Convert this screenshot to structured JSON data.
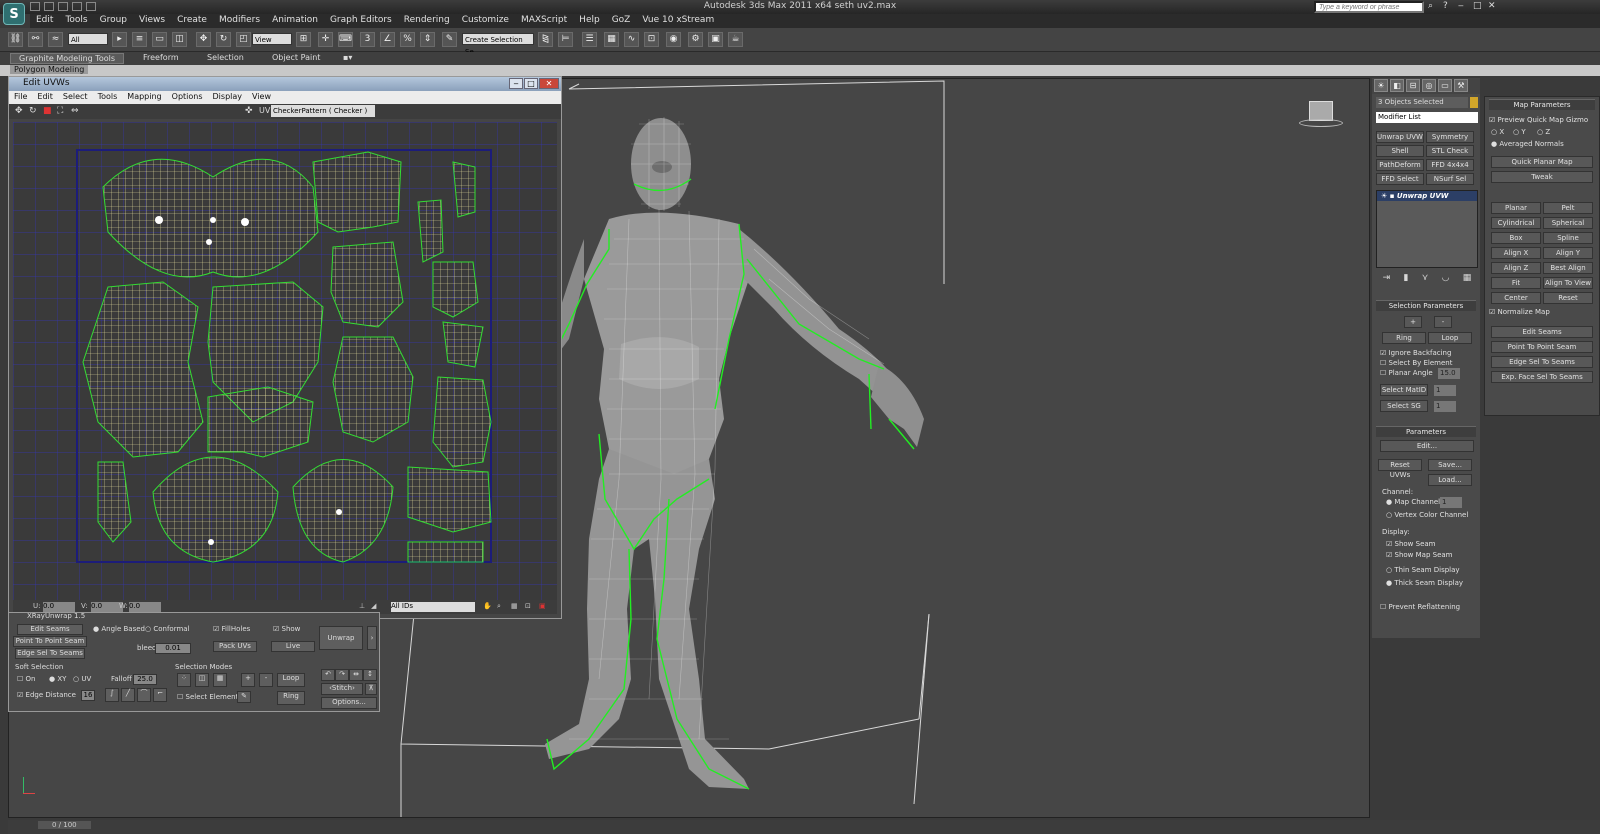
{
  "window": {
    "app_title": "Autodesk 3ds Max  2011 x64      seth uv2.max",
    "logo": "S",
    "search_placeholder": "Type a keyword or phrase"
  },
  "menu": [
    "Edit",
    "Tools",
    "Group",
    "Views",
    "Create",
    "Modifiers",
    "Animation",
    "Graph Editors",
    "Rendering",
    "Customize",
    "MAXScript",
    "Help",
    "GoZ",
    "Vue 10 xStream"
  ],
  "toolbar": {
    "filter": "All",
    "ref_coord": "View",
    "named_selection": "Create Selection Se"
  },
  "ribbon": {
    "tabs": [
      "Graphite Modeling Tools",
      "Freeform",
      "Selection",
      "Object Paint"
    ],
    "sub_tab": "Polygon Modeling"
  },
  "uv_editor": {
    "title": "Edit UVWs",
    "menu": [
      "File",
      "Edit",
      "Select",
      "Tools",
      "Mapping",
      "Options",
      "Display",
      "View"
    ],
    "uv_label": "UV",
    "texture": "CheckerPattern ( Checker )",
    "status": {
      "u_label": "U:",
      "u_value": "0.0",
      "v_label": "V:",
      "v_value": "0.0",
      "w_label": "W:",
      "w_value": "0.0",
      "ids": "All IDs"
    }
  },
  "xray": {
    "title": "XRayUnwrap 1.5",
    "edit_seams": "Edit Seams",
    "point_to_point": "Point To Point Seam",
    "edge_sel": "Edge Sel To Seams",
    "angle_based": "Angle Based",
    "conformal": "Conformal",
    "fill_holes": "FillHoles",
    "show": "Show",
    "unwrap": "Unwrap",
    "bleed_label": "bleed",
    "bleed_value": "0.01",
    "pack_uvs": "Pack UVs",
    "live": "Live",
    "soft_selection": "Soft Selection",
    "on": "On",
    "xy": "XY",
    "uv": "UV",
    "falloff_label": "Falloff",
    "falloff_value": "25.0",
    "edge_distance": "Edge Distance",
    "edge_distance_value": "16",
    "selection_modes": "Selection Modes",
    "select_element": "Select Element",
    "loop": "Loop",
    "ring": "Ring",
    "stitch": "Stitch",
    "options": "Options..."
  },
  "command_panel": {
    "selection_info": "3 Objects Selected",
    "modifier_list": "Modifier List",
    "mod_buttons": [
      "Unwrap UVW",
      "Symmetry",
      "Shell",
      "STL Check",
      "PathDeform",
      "FFD 4x4x4",
      "FFD Select",
      "NSurf Sel"
    ],
    "stack_item": "Unwrap UVW",
    "selection_parameters": "Selection Parameters",
    "plus": "+",
    "minus": "-",
    "ring": "Ring",
    "loop": "Loop",
    "ignore_backfacing": "Ignore Backfacing",
    "select_by_element": "Select By Element",
    "planar_angle": "Planar Angle",
    "planar_angle_value": "15.0",
    "select_matid": "Select MatID",
    "select_sg": "Select SG",
    "spin_value": "1",
    "parameters": "Parameters",
    "edit": "Edit...",
    "reset_uvws": "Reset UVWs",
    "save": "Save...",
    "load": "Load...",
    "channel": "Channel:",
    "map_channel": "Map Channel:",
    "map_channel_value": "1",
    "vertex_color_channel": "Vertex Color Channel",
    "display": "Display:",
    "show_seam": "Show Seam",
    "show_map_seam": "Show Map Seam",
    "thin_seam": "Thin Seam Display",
    "thick_seam": "Thick Seam Display",
    "prevent_reflattening": "Prevent Reflattening"
  },
  "map_parameters": {
    "title": "Map Parameters",
    "preview": "Preview Quick Map Gizmo",
    "x": "X",
    "y": "Y",
    "z": "Z",
    "averaged_normals": "Averaged Normals",
    "quick_planar": "Quick Planar Map",
    "tweak": "Tweak",
    "buttons": [
      "Planar",
      "Pelt",
      "Cylindrical",
      "Spherical",
      "Box",
      "Spline",
      "Align X",
      "Align Y",
      "Align Z",
      "Best Align",
      "Fit",
      "Align To View",
      "Center",
      "Reset"
    ],
    "normalize_map": "Normalize Map",
    "edit_seams": "Edit Seams",
    "point_to_point": "Point To Point Seam",
    "edge_sel": "Edge Sel To Seams",
    "exp_face": "Exp. Face Sel To Seams"
  },
  "timeline": {
    "frame": "0 / 100"
  },
  "colors": {
    "uv_edges": "#e9e3a0",
    "seams": "#33dd33",
    "grid": "#3535b8"
  }
}
